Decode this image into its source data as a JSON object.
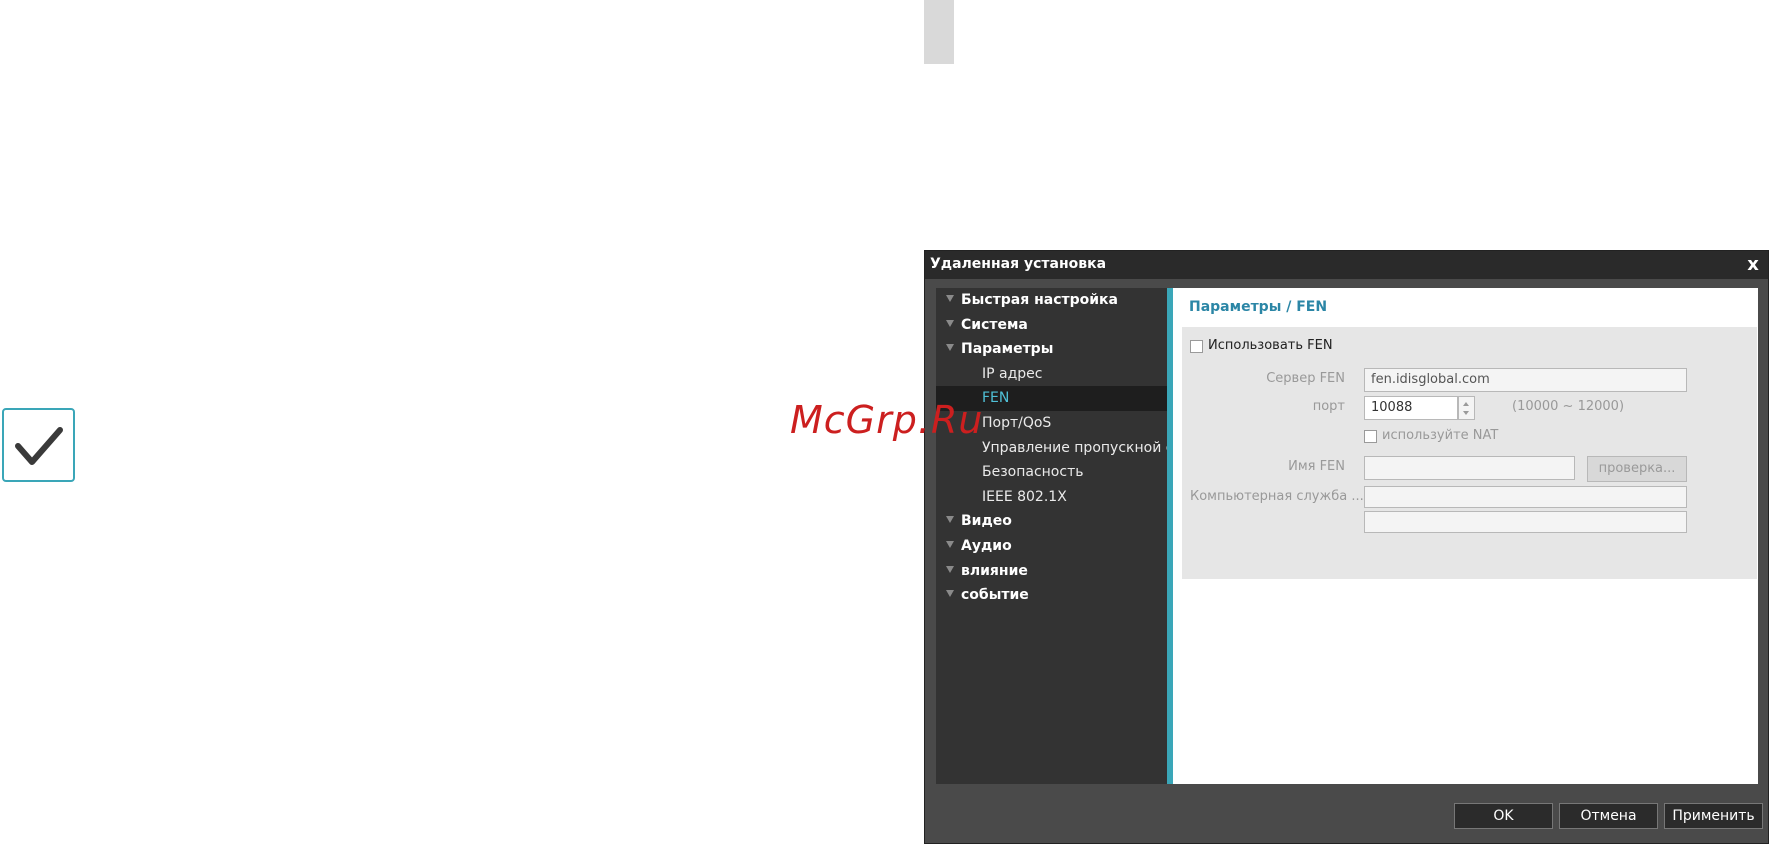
{
  "watermark": "McGrp.Ru",
  "window": {
    "title": "Удаленная установка",
    "close": "x"
  },
  "tree": {
    "items": [
      {
        "label": "Быстрая настройка",
        "level": "parent"
      },
      {
        "label": "Система",
        "level": "parent"
      },
      {
        "label": "Параметры",
        "level": "parent"
      },
      {
        "label": "IP адрес",
        "level": "child"
      },
      {
        "label": "FEN",
        "level": "child",
        "selected": true
      },
      {
        "label": "Порт/QoS",
        "level": "child"
      },
      {
        "label": "Управление пропускной способностью",
        "level": "child"
      },
      {
        "label": "Безопасность",
        "level": "child"
      },
      {
        "label": "IEEE 802.1X",
        "level": "child"
      },
      {
        "label": "Видео",
        "level": "parent"
      },
      {
        "label": "Аудио",
        "level": "parent"
      },
      {
        "label": "влияние",
        "level": "parent"
      },
      {
        "label": "событие",
        "level": "parent"
      }
    ]
  },
  "content": {
    "title": "Параметры / FEN",
    "use_fen_label": "Использовать FEN",
    "server_label": "Сервер FEN",
    "server_value": "fen.idisglobal.com",
    "port_label": "порт",
    "port_value": "10088",
    "port_range": "(10000 ~ 12000)",
    "nat_label": "используйте NAT",
    "name_label": "Имя FEN",
    "name_value": "",
    "check_button": "проверка...",
    "service_label": "Компьютерная служба ...",
    "service_value_1": "",
    "service_value_2": ""
  },
  "buttons": {
    "ok": "OK",
    "cancel": "Отмена",
    "apply": "Применить"
  },
  "colors": {
    "accent": "#3aa6b8",
    "selected_text": "#4fc0d6",
    "watermark": "#cc1f1f"
  }
}
